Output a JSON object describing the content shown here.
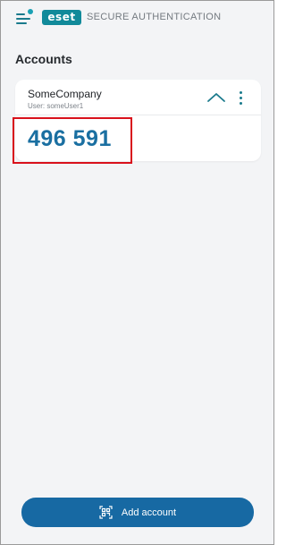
{
  "header": {
    "logo_text": "eset",
    "brand_text": "SECURE AUTHENTICATION",
    "accent_color": "#118a9a"
  },
  "page": {
    "title": "Accounts"
  },
  "account": {
    "company": "SomeCompany",
    "user_line": "User: someUser1",
    "otp_code": "496 591",
    "otp_color": "#1a6fa1",
    "highlight_color": "#d9111c"
  },
  "actions": {
    "add_account_label": "Add account",
    "button_color": "#1769a3"
  },
  "icons": {
    "menu": "hamburger-menu-icon",
    "collapse": "chevron-up-icon",
    "more": "more-vertical-icon",
    "add": "qr-code-scan-icon"
  }
}
